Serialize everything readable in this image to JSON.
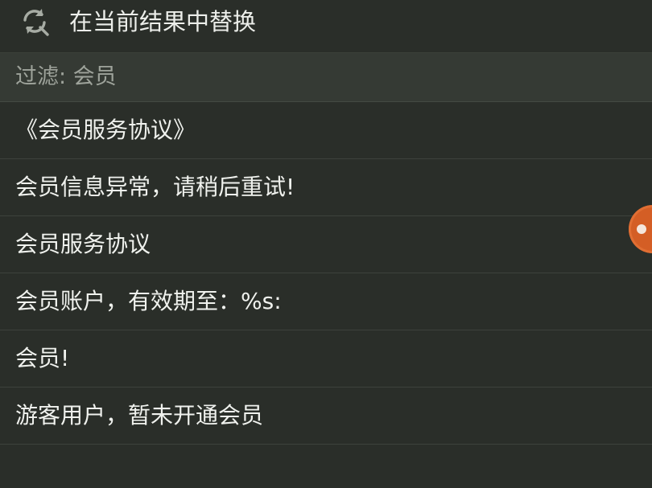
{
  "action": {
    "icon": "replace-refresh-icon",
    "label": "在当前结果中替换"
  },
  "filter": {
    "label": "过滤: 会员"
  },
  "results": [
    "《会员服务协议》",
    "会员信息异常，请稍后重试!",
    "会员服务协议",
    "会员账户，有效期至：%s:",
    "会员!",
    "游客用户，暂未开通会员"
  ],
  "colors": {
    "background": "#2a2e29",
    "filter_background": "#353a34",
    "text": "#f0f2ee",
    "muted_text": "#9ea39b",
    "floating_ball": "#d45e25"
  }
}
